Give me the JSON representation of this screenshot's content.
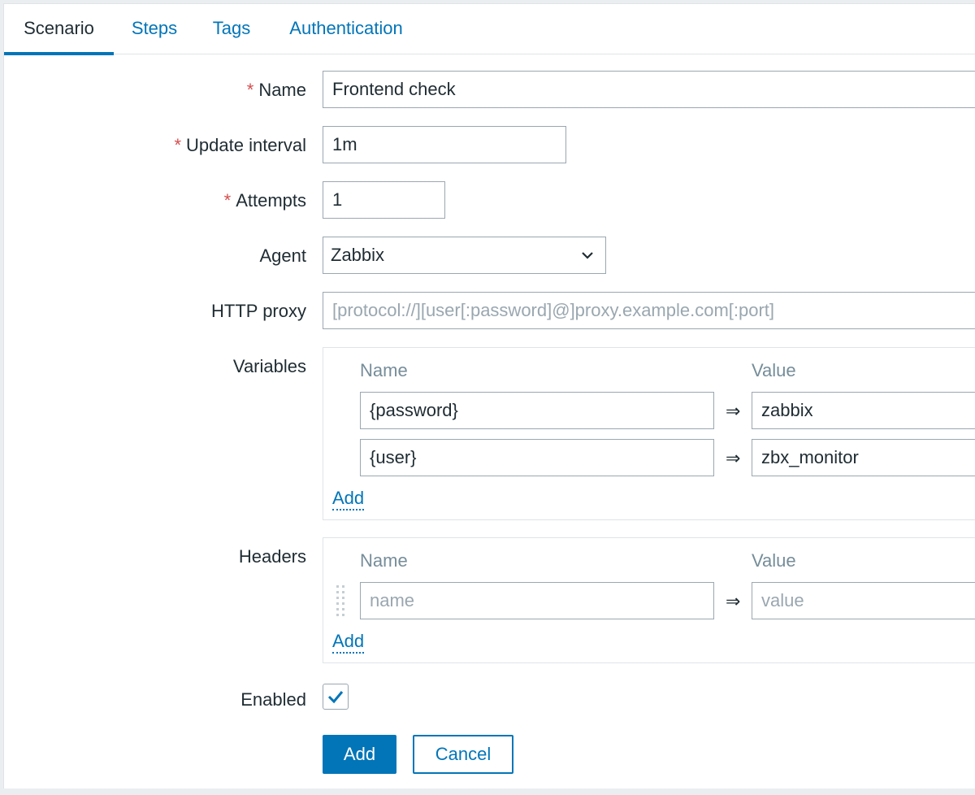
{
  "tabs": [
    {
      "label": "Scenario",
      "active": true
    },
    {
      "label": "Steps",
      "active": false
    },
    {
      "label": "Tags",
      "active": false
    },
    {
      "label": "Authentication",
      "active": false
    }
  ],
  "required_marker": "*",
  "form": {
    "name": {
      "label": "Name",
      "value": "Frontend check"
    },
    "update_interval": {
      "label": "Update interval",
      "value": "1m"
    },
    "attempts": {
      "label": "Attempts",
      "value": "1"
    },
    "agent": {
      "label": "Agent",
      "selected": "Zabbix"
    },
    "http_proxy": {
      "label": "HTTP proxy",
      "value": "",
      "placeholder": "[protocol://][user[:password]@]proxy.example.com[:port]"
    },
    "variables": {
      "label": "Variables",
      "col_name": "Name",
      "col_value": "Value",
      "arrow": "⇒",
      "rows": [
        {
          "name": "{password}",
          "value": "zabbix"
        },
        {
          "name": "{user}",
          "value": "zbx_monitor"
        }
      ],
      "add_label": "Add"
    },
    "headers": {
      "label": "Headers",
      "col_name": "Name",
      "col_value": "Value",
      "arrow": "⇒",
      "rows": [
        {
          "name": "",
          "value": "",
          "name_placeholder": "name",
          "value_placeholder": "value"
        }
      ],
      "add_label": "Add"
    },
    "enabled": {
      "label": "Enabled",
      "checked": true
    }
  },
  "buttons": {
    "add": "Add",
    "cancel": "Cancel"
  },
  "colors": {
    "accent": "#0275b8",
    "required": "#d64e4e",
    "muted": "#768d99",
    "border": "#9aa7b0"
  }
}
